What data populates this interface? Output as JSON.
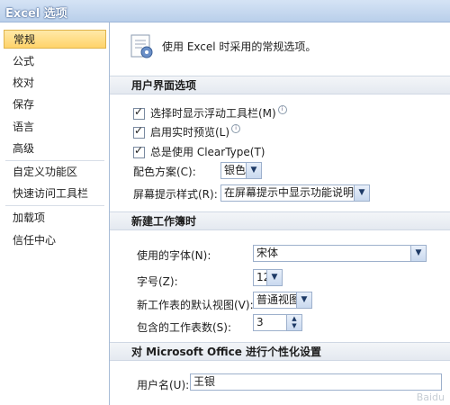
{
  "window": {
    "title": "Excel 选项"
  },
  "sidebar": {
    "items": [
      {
        "label": "常规"
      },
      {
        "label": "公式"
      },
      {
        "label": "校对"
      },
      {
        "label": "保存"
      },
      {
        "label": "语言"
      },
      {
        "label": "高级"
      },
      {
        "label": "自定义功能区"
      },
      {
        "label": "快速访问工具栏"
      },
      {
        "label": "加载项"
      },
      {
        "label": "信任中心"
      }
    ]
  },
  "main": {
    "header_text": "使用 Excel 时采用的常规选项。",
    "ui_section": {
      "title": "用户界面选项",
      "checkboxes": [
        {
          "label": "选择时显示浮动工具栏(M)",
          "checked": true
        },
        {
          "label": "启用实时预览(L)",
          "checked": true
        },
        {
          "label": "总是使用 ClearType(T)",
          "checked": true
        }
      ],
      "color_scheme_label": "配色方案(C):",
      "color_scheme_value": "银色",
      "tooltip_style_label": "屏幕提示样式(R):",
      "tooltip_style_value": "在屏幕提示中显示功能说明"
    },
    "workbook_section": {
      "title": "新建工作簿时",
      "font_label": "使用的字体(N):",
      "font_value": "宋体",
      "size_label": "字号(Z):",
      "size_value": "12",
      "view_label": "新工作表的默认视图(V):",
      "view_value": "普通视图",
      "sheets_label": "包含的工作表数(S):",
      "sheets_value": "3"
    },
    "personal_section": {
      "title": "对 Microsoft Office 进行个性化设置",
      "username_label": "用户名(U):",
      "username_value": "王银"
    }
  },
  "watermark": "Baidu"
}
